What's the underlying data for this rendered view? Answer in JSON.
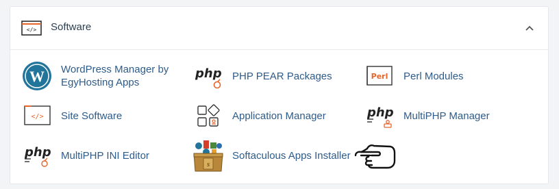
{
  "panel": {
    "title": "Software"
  },
  "items": [
    {
      "label": "WordPress Manager by EgyHosting Apps",
      "icon": "wordpress-icon"
    },
    {
      "label": "PHP PEAR Packages",
      "icon": "php-pear-icon"
    },
    {
      "label": "Perl Modules",
      "icon": "perl-icon"
    },
    {
      "label": "Site Software",
      "icon": "code-window-icon"
    },
    {
      "label": "Application Manager",
      "icon": "application-manager-icon"
    },
    {
      "label": "MultiPHP Manager",
      "icon": "multiphp-manager-icon"
    },
    {
      "label": "MultiPHP INI Editor",
      "icon": "multiphp-ini-icon"
    },
    {
      "label": "Softaculous Apps Installer",
      "icon": "softaculous-icon"
    }
  ],
  "icon_text": {
    "php": "php",
    "perl": "Perl",
    "code": "</>"
  },
  "colors": {
    "link": "#2d5b8a",
    "title": "#2c3e50",
    "accent_orange": "#e8652a",
    "wordpress_blue": "#21759b"
  }
}
